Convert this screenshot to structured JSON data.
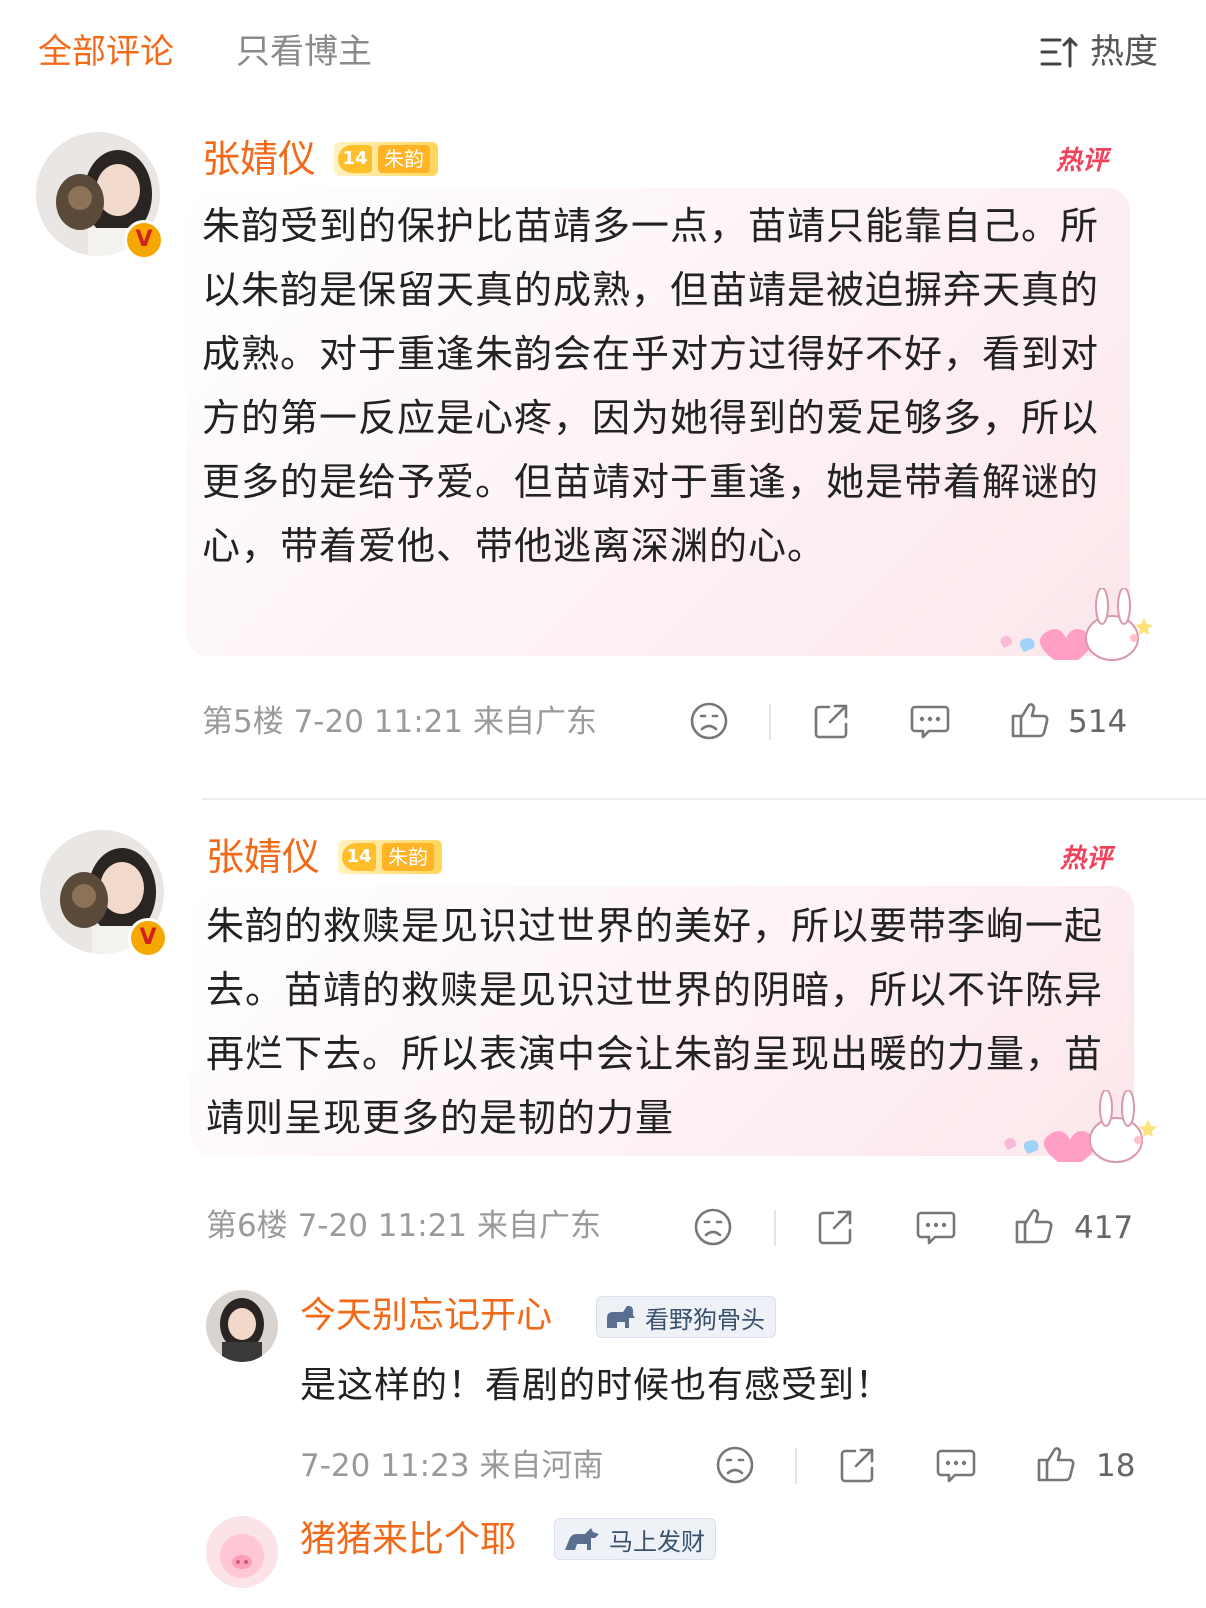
{
  "tabs": {
    "all_comments": "全部评论",
    "author_only": "只看博主",
    "sort_label": "热度"
  },
  "comments": [
    {
      "username": "张婧仪",
      "level": "14",
      "fan_group": "朱韵",
      "hot_label": "热评",
      "text": "朱韵受到的保护比苗靖多一点，苗靖只能靠自己。所以朱韵是保留天真的成熟，但苗靖是被迫摒弃天真的成熟。对于重逢朱韵会在乎对方过得好不好，看到对方的第一反应是心疼，因为她得到的爱足够多，所以更多的是给予爱。但苗靖对于重逢，她是带着解谜的心，带着爱他、带他逃离深渊的心。",
      "meta": "第5楼  7-20 11:21  来自广东",
      "likes": "514"
    },
    {
      "username": "张婧仪",
      "level": "14",
      "fan_group": "朱韵",
      "hot_label": "热评",
      "text": "朱韵的救赎是见识过世界的美好，所以要带李峋一起去。苗靖的救赎是见识过世界的阴暗，所以不许陈异再烂下去。所以表演中会让朱韵呈现出暖的力量，苗靖则呈现更多的是韧的力量",
      "meta": "第6楼  7-20 11:21  来自广东",
      "likes": "417"
    }
  ],
  "replies": [
    {
      "username": "今天别忘记开心",
      "tag": "看野狗骨头",
      "text": "是这样的！看剧的时候也有感受到！",
      "meta": "7-20 11:23  来自河南",
      "likes": "18"
    },
    {
      "username": "猪猪来比个耶",
      "tag": "马上发财"
    }
  ],
  "icons": {
    "sort": "sort-icon",
    "dislike": "sad-face-icon",
    "share": "share-icon",
    "comment": "comment-icon",
    "like": "thumbs-up-icon",
    "verified": "verified-v-icon",
    "bunny_sticker": "bunny-sticker-icon"
  },
  "colors": {
    "accent": "#f46a1a",
    "hot": "#f2415a",
    "verified_badge": "#f7a800"
  }
}
